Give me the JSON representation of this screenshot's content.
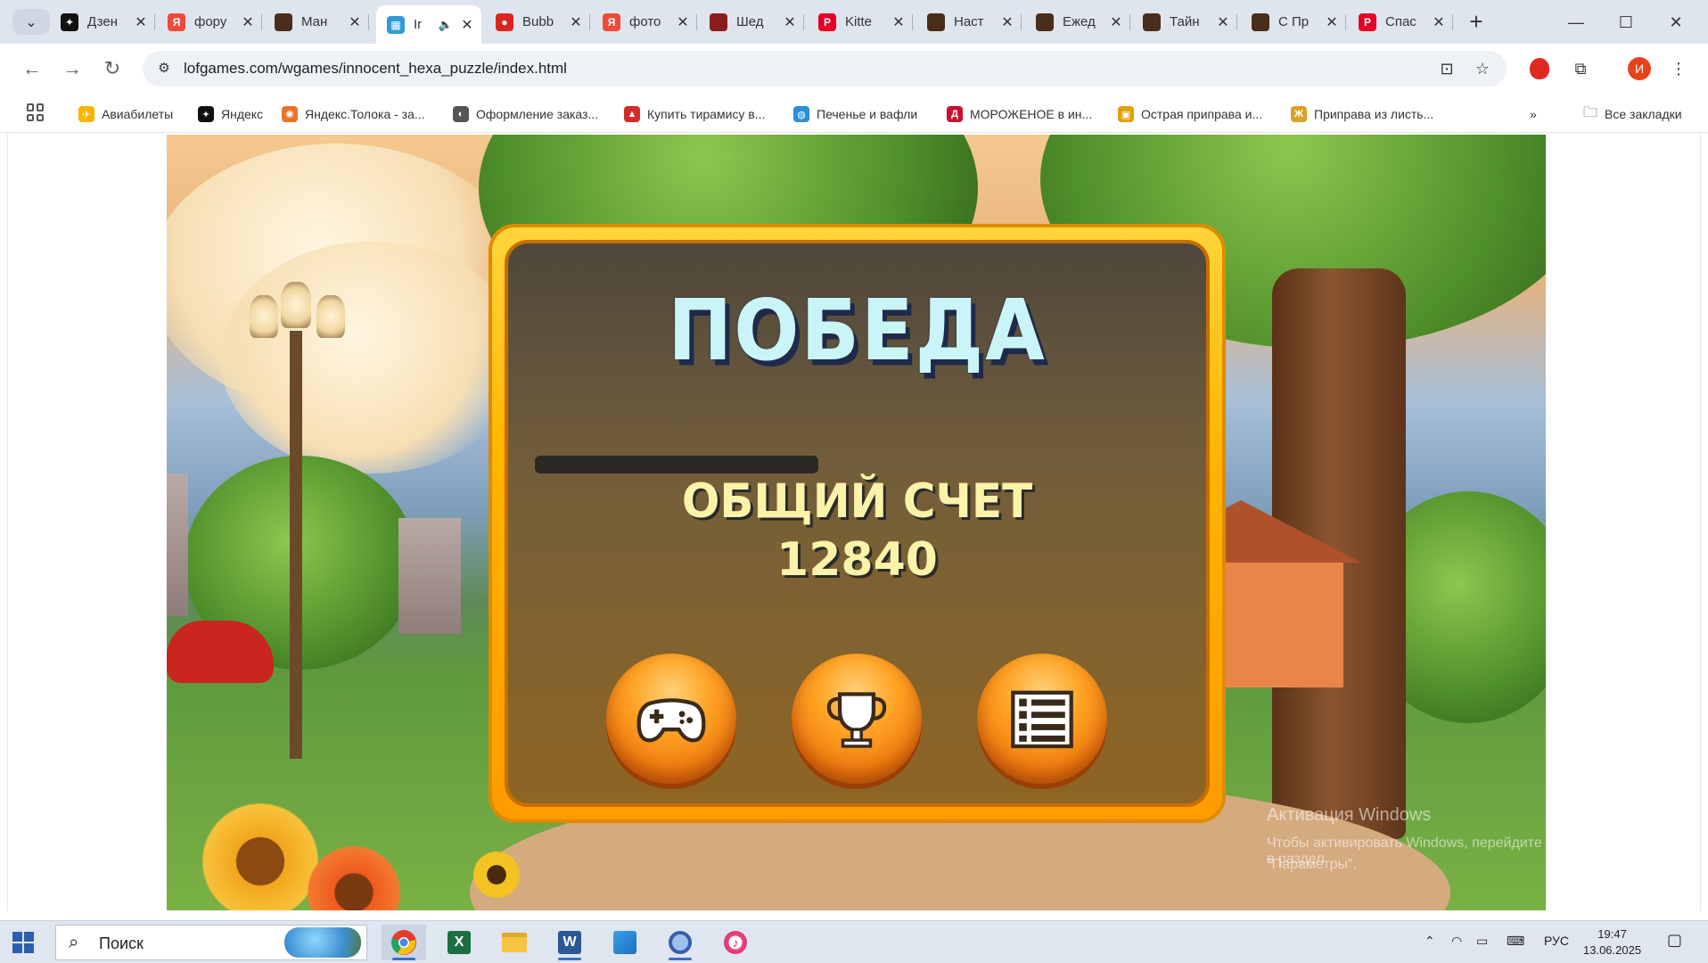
{
  "browser": {
    "tabs": [
      {
        "title": "Дзен",
        "favicon": "zen-icon",
        "color": "#111111",
        "glyph": "✦"
      },
      {
        "title": "фору",
        "favicon": "yandex-icon",
        "color": "#f04b3a",
        "glyph": "Я"
      },
      {
        "title": "Ман",
        "favicon": "thumbnail-icon",
        "color": "#4a2d1a",
        "glyph": ""
      },
      {
        "title": "Ir",
        "favicon": "puzzle-icon",
        "color": "#2e9bd6",
        "glyph": "▦",
        "active": true
      },
      {
        "title": "Bubb",
        "favicon": "bubble-icon",
        "color": "#d8261f",
        "glyph": "●"
      },
      {
        "title": "фото",
        "favicon": "yandex-icon",
        "color": "#f04b3a",
        "glyph": "Я"
      },
      {
        "title": "Шед",
        "favicon": "thumbnail-icon",
        "color": "#8b1d1d",
        "glyph": ""
      },
      {
        "title": "Kitte",
        "favicon": "pinterest-icon",
        "color": "#e60023",
        "glyph": "P"
      },
      {
        "title": "Наст",
        "favicon": "thumbnail-icon",
        "color": "#4a2d1a",
        "glyph": ""
      },
      {
        "title": "Ежед",
        "favicon": "thumbnail-icon",
        "color": "#4a2d1a",
        "glyph": ""
      },
      {
        "title": "Тайн",
        "favicon": "thumbnail-icon",
        "color": "#4a2d1a",
        "glyph": ""
      },
      {
        "title": "С Пр",
        "favicon": "thumbnail-icon",
        "color": "#4a2d1a",
        "glyph": ""
      },
      {
        "title": "Спас",
        "favicon": "pinterest-icon",
        "color": "#e60023",
        "glyph": "P"
      }
    ],
    "url": "lofgames.com/wgames/innocent_hexa_puzzle/index.html",
    "avatar_letter": "И",
    "bookmarks": [
      {
        "label": "Авиабилеты",
        "color": "#f7b500",
        "glyph": "✈"
      },
      {
        "label": "Яндекс",
        "color": "#111111",
        "glyph": "✦"
      },
      {
        "label": "Яндекс.Толока - за...",
        "color": "#e8742a",
        "glyph": "✺"
      },
      {
        "label": "Оформление заказ...",
        "color": "#555555",
        "glyph": "◐"
      },
      {
        "label": "Купить тирамису в...",
        "color": "#d22b2b",
        "glyph": "▲"
      },
      {
        "label": "Печенье и вафли",
        "color": "#2a8fd6",
        "glyph": "◍"
      },
      {
        "label": "МОРОЖЕНОЕ в ин...",
        "color": "#c8102e",
        "glyph": "Д"
      },
      {
        "label": "Острая приправа и...",
        "color": "#e0a100",
        "glyph": "▣"
      },
      {
        "label": "Приправа из листь...",
        "color": "#d8a32a",
        "glyph": "Ж"
      }
    ],
    "all_bookmarks_label": "Все закладки"
  },
  "game": {
    "title": "ПОБЕДА",
    "score_label": "ОБЩИЙ СЧЕТ",
    "score_value": "12840",
    "buttons": [
      {
        "name": "play-again-button",
        "icon": "gamepad-icon"
      },
      {
        "name": "leaderboard-button",
        "icon": "trophy-icon"
      },
      {
        "name": "menu-button",
        "icon": "list-icon"
      }
    ]
  },
  "watermark": {
    "line1": "Активация Windows",
    "line2": "Чтобы активировать Windows, перейдите в раздел",
    "line3": "\"Параметры\"."
  },
  "taskbar": {
    "search_placeholder": "Поиск",
    "language": "РУС",
    "time": "19:47",
    "date": "13.06.2025"
  }
}
